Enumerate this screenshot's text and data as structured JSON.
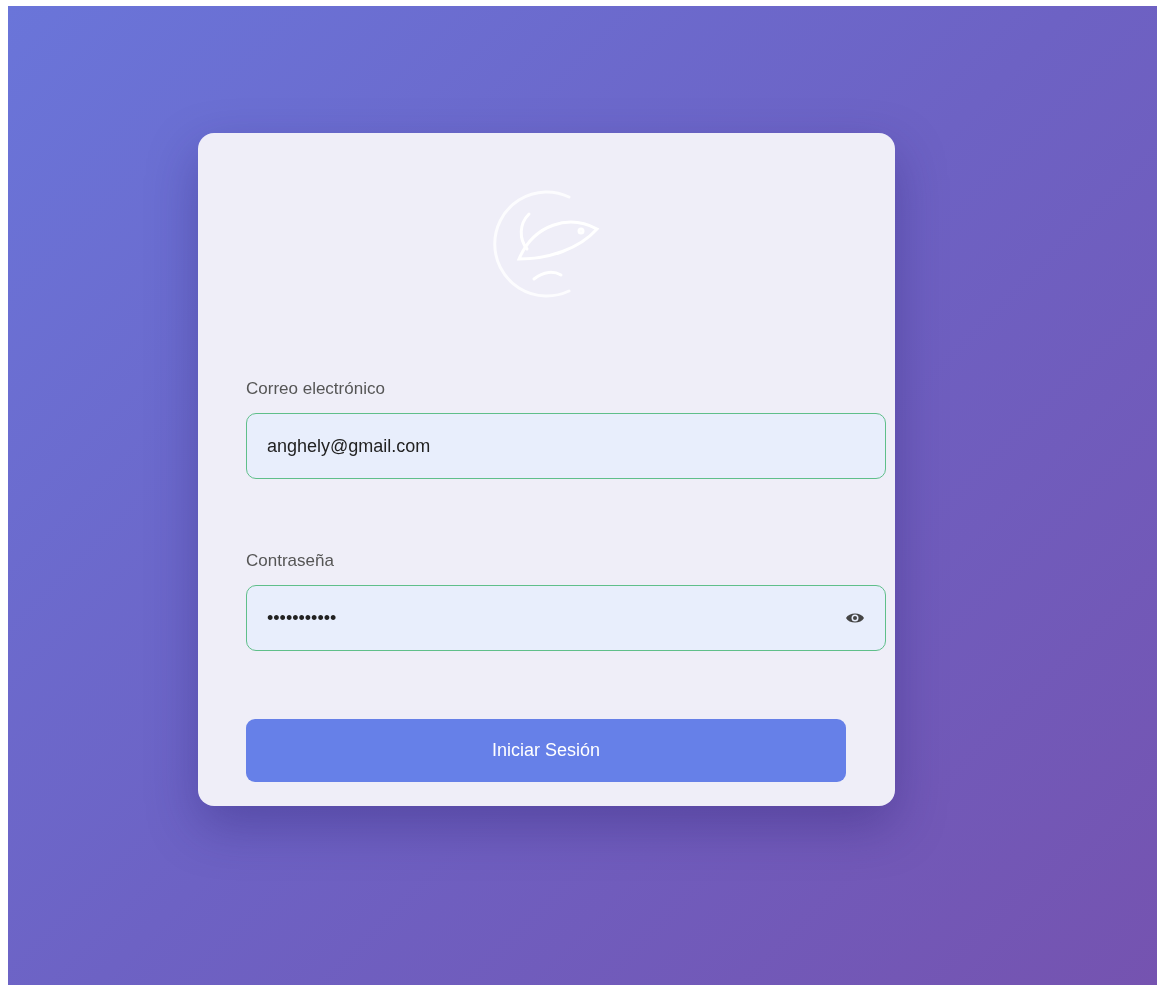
{
  "login_form": {
    "fields": [
      {
        "kind": "text",
        "label": "Correo electrónico",
        "value": "anghely@gmail.com"
      },
      {
        "kind": "password",
        "label": "Contraseña",
        "value": "•••••••••••"
      }
    ],
    "submit_button": "Iniciar Sesión"
  }
}
